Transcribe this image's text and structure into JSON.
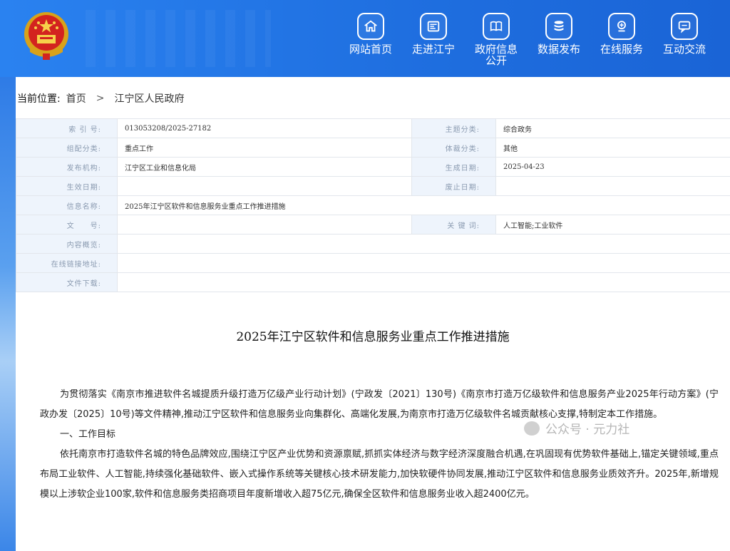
{
  "header": {
    "nav": [
      {
        "label": "网站首页",
        "icon": "home-icon"
      },
      {
        "label": "走进江宁",
        "icon": "info-card-icon"
      },
      {
        "label": "政府信息\n公开",
        "icon": "book-icon"
      },
      {
        "label": "数据发布",
        "icon": "database-icon"
      },
      {
        "label": "在线服务",
        "icon": "service-icon"
      },
      {
        "label": "互动交流",
        "icon": "chat-icon"
      }
    ]
  },
  "breadcrumb": {
    "label": "当前位置:",
    "items": [
      "首页",
      "江宁区人民政府"
    ],
    "separator": ">"
  },
  "meta": {
    "index_no_label": "索 引 号:",
    "index_no": "013053208/2025-27182",
    "topic_label": "主题分类:",
    "topic": "综合政务",
    "group_label": "组配分类:",
    "group": "重点工作",
    "genre_label": "体裁分类:",
    "genre": "其他",
    "publisher_label": "发布机构:",
    "publisher": "江宁区工业和信息化局",
    "created_label": "生成日期:",
    "created": "2025-04-23",
    "effective_label": "生效日期:",
    "effective": "",
    "expire_label": "废止日期:",
    "expire": "",
    "name_label": "信息名称:",
    "name": "2025年江宁区软件和信息服务业重点工作推进措施",
    "doc_no_label": "文　　号:",
    "doc_no": "",
    "keywords_label": "关 键 词:",
    "keywords": "人工智能;工业软件",
    "summary_label": "内容概览:",
    "summary": "",
    "link_label": "在线链接地址:",
    "link": "",
    "download_label": "文件下载:",
    "download": ""
  },
  "article": {
    "title": "2025年江宁区软件和信息服务业重点工作推进措施",
    "p1": "为贯彻落实《南京市推进软件名城提质升级打造万亿级产业行动计划》(宁政发〔2021〕130号)《南京市打造万亿级软件和信息服务产业2025年行动方案》(宁政办发〔2025〕10号)等文件精神,推动江宁区软件和信息服务业向集群化、高端化发展,为南京市打造万亿级软件名城贡献核心支撑,特制定本工作措施。",
    "h1": "一、工作目标",
    "p2": "依托南京市打造软件名城的特色品牌效应,围绕江宁区产业优势和资源禀赋,抓抓实体经济与数字经济深度融合机遇,在巩固现有优势软件基础上,锚定关键领域,重点布局工业软件、人工智能,持续强化基础软件、嵌入式操作系统等关键核心技术研发能力,加快软硬件协同发展,推动江宁区软件和信息服务业质效齐升。2025年,新增规模以上涉软企业100家,软件和信息服务类招商项目年度新增收入超75亿元,确保全区软件和信息服务业收入超2400亿元。"
  },
  "watermark": {
    "text": "公众号 · 元力社"
  }
}
